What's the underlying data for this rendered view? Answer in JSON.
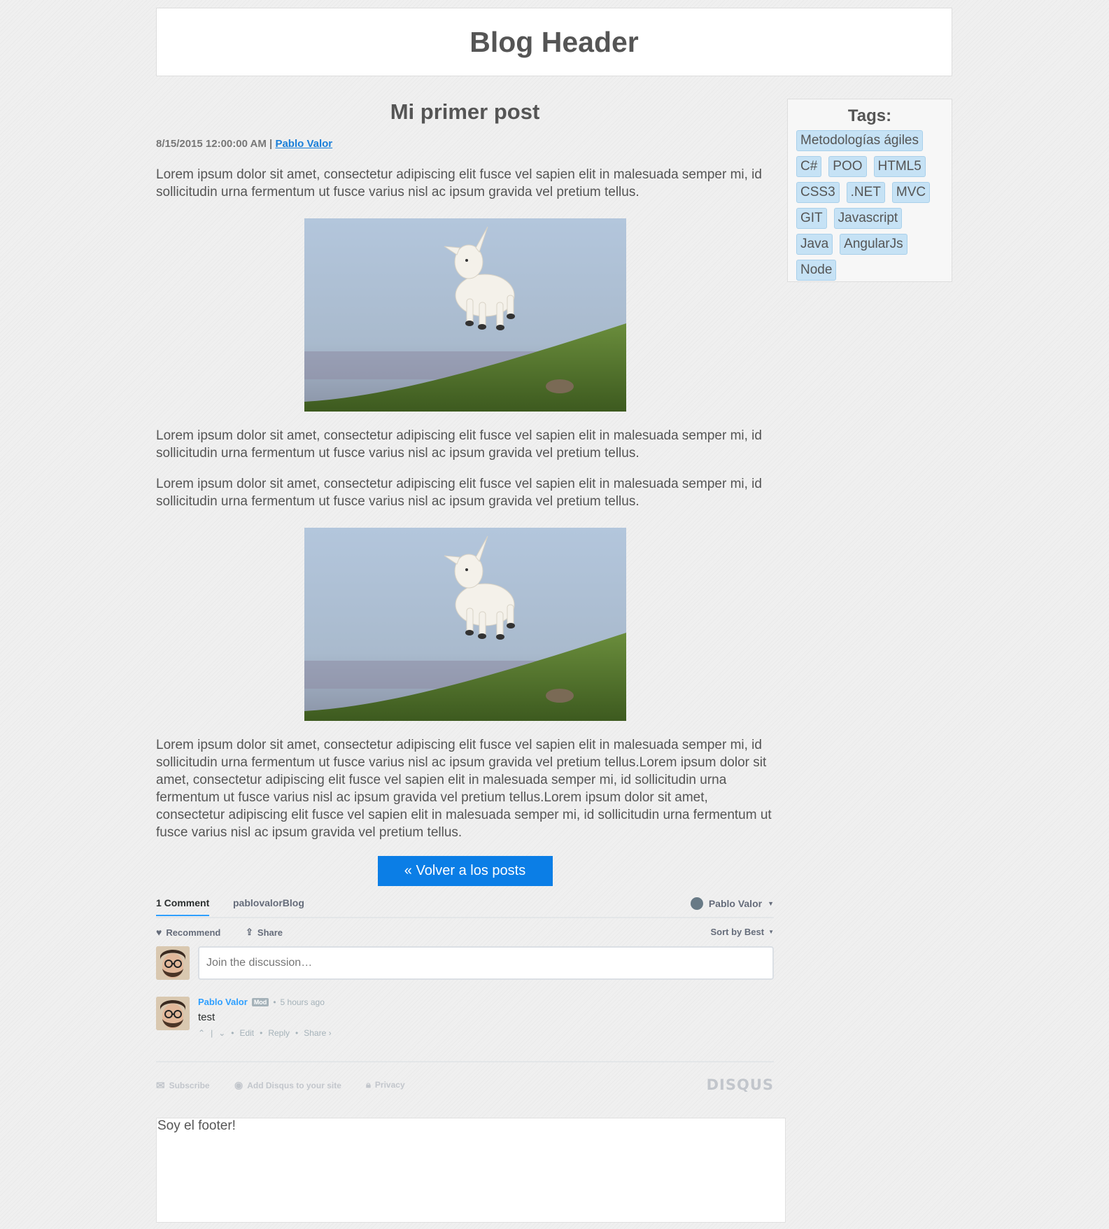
{
  "header": {
    "title": "Blog Header"
  },
  "post": {
    "title": "Mi primer post",
    "date": "8/15/2015 12:00:00 AM",
    "separator": " | ",
    "author": "Pablo Valor",
    "paragraphs": [
      "Lorem ipsum dolor sit amet, consectetur adipiscing elit fusce vel sapien elit in malesuada semper mi, id sollicitudin urna fermentum ut fusce varius nisl ac ipsum gravida vel pretium tellus.",
      "Lorem ipsum dolor sit amet, consectetur adipiscing elit fusce vel sapien elit in malesuada semper mi, id sollicitudin urna fermentum ut fusce varius nisl ac ipsum gravida vel pretium tellus.",
      "Lorem ipsum dolor sit amet, consectetur adipiscing elit fusce vel sapien elit in malesuada semper mi, id sollicitudin urna fermentum ut fusce varius nisl ac ipsum gravida vel pretium tellus.",
      "Lorem ipsum dolor sit amet, consectetur adipiscing elit fusce vel sapien elit in malesuada semper mi, id sollicitudin urna fermentum ut fusce varius nisl ac ipsum gravida vel pretium tellus.Lorem ipsum dolor sit amet, consectetur adipiscing elit fusce vel sapien elit in malesuada semper mi, id sollicitudin urna fermentum ut fusce varius nisl ac ipsum gravida vel pretium tellus.Lorem ipsum dolor sit amet, consectetur adipiscing elit fusce vel sapien elit in malesuada semper mi, id sollicitudin urna fermentum ut fusce varius nisl ac ipsum gravida vel pretium tellus."
    ],
    "back_button": "« Volver a los posts"
  },
  "disqus": {
    "comment_count": "1 Comment",
    "site_name": "pablovalorBlog",
    "user_name": "Pablo Valor",
    "recommend": "Recommend",
    "share": "Share",
    "sort": "Sort by Best",
    "input_placeholder": "Join the discussion…",
    "comment": {
      "author": "Pablo Valor",
      "badge": "Mod",
      "time": "5 hours ago",
      "text": "test",
      "edit": "Edit",
      "reply": "Reply",
      "share": "Share ›"
    },
    "footer": {
      "subscribe": "Subscribe",
      "add": "Add Disqus to your site",
      "privacy": "Privacy",
      "logo": "DISQUS"
    }
  },
  "sidebar": {
    "title": "Tags:",
    "tags": [
      "Metodologías ágiles",
      "C#",
      "POO",
      "HTML5",
      "CSS3",
      ".NET",
      "MVC",
      "GIT",
      "Javascript",
      "Java",
      "AngularJs",
      "Node"
    ]
  },
  "footer": {
    "text": "Soy el footer!"
  },
  "colors": {
    "accent": "#0b7ee6",
    "link": "#1a7fd9",
    "tag_bg": "#c6e2f5",
    "disqus_blue": "#2e9fff"
  }
}
